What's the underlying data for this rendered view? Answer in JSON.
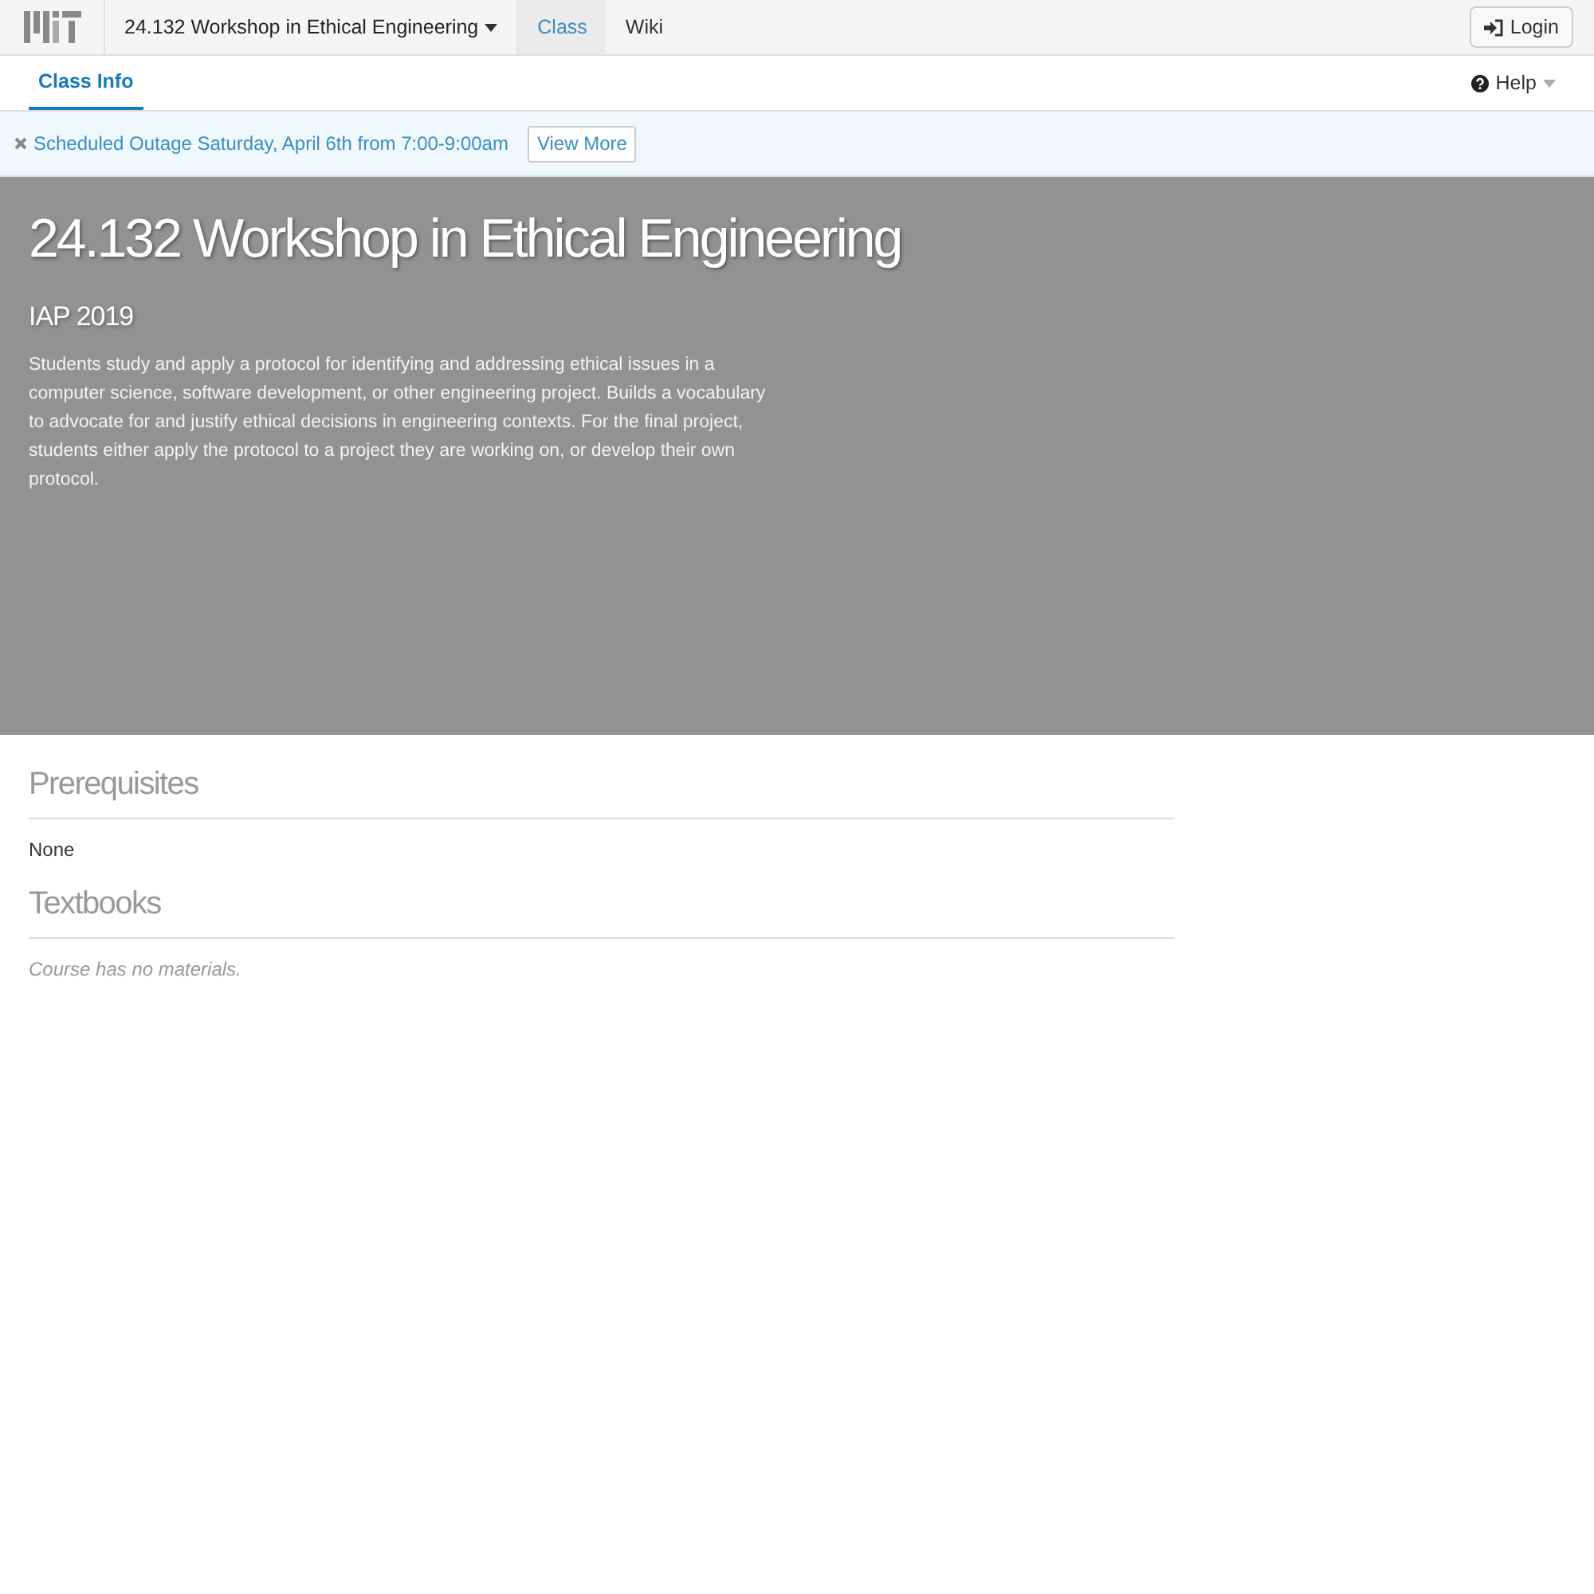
{
  "navbar": {
    "course_menu": "24.132 Workshop in Ethical Engineering",
    "tabs": [
      {
        "label": "Class",
        "selected": true
      },
      {
        "label": "Wiki",
        "selected": false
      }
    ],
    "login": "Login"
  },
  "subnav": {
    "tabs": [
      {
        "label": "Class Info",
        "selected": true
      }
    ],
    "help": "Help"
  },
  "alert": {
    "message": "Scheduled Outage Saturday, April 6th from 7:00-9:00am",
    "button": "View More"
  },
  "hero": {
    "title": "24.132 Workshop in Ethical Engineering",
    "term": "IAP 2019",
    "description": "Students study and apply a protocol for identifying and addressing ethical issues in a computer science, software development, or other engineering project. Builds a vocabulary to advocate for and justify ethical decisions in engineering contexts. For the final project, students either apply the protocol to a project they are working on, or develop their own protocol."
  },
  "sections": [
    {
      "heading": "Prerequisites",
      "kind": "text",
      "body": "None"
    },
    {
      "heading": "Textbooks",
      "kind": "empty",
      "body": "Course has no materials."
    }
  ]
}
